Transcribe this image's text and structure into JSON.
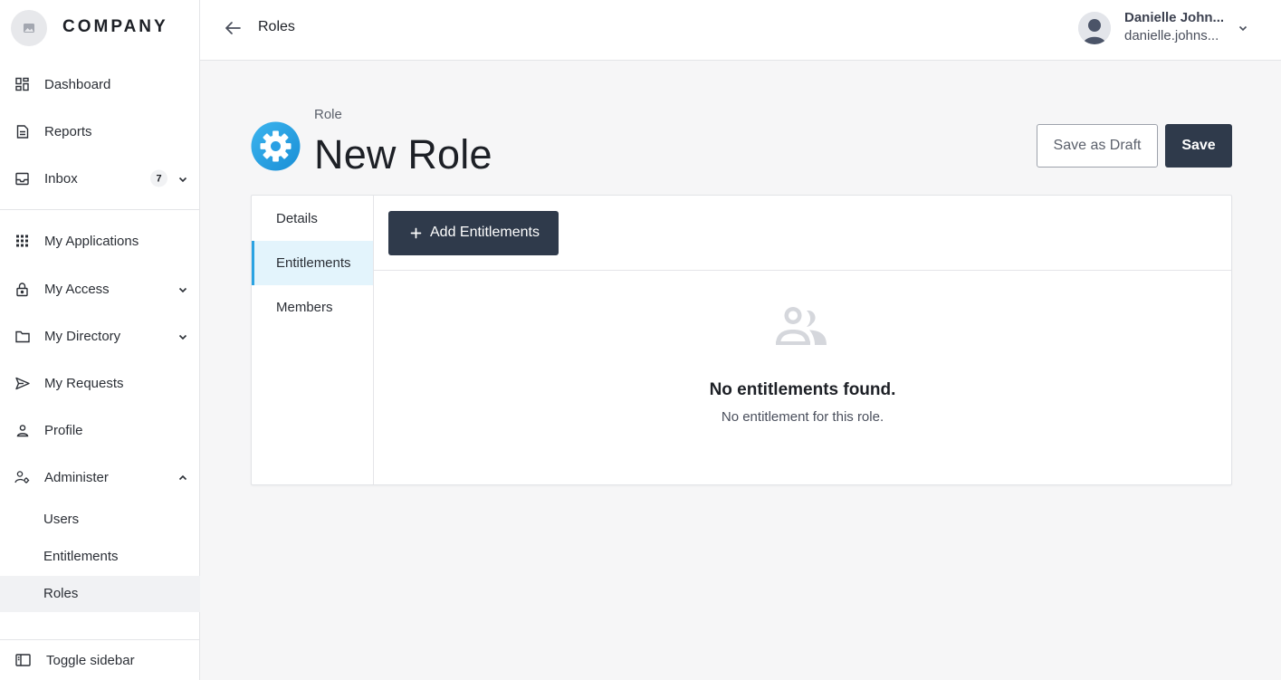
{
  "brand": {
    "name": "COMPANY",
    "logo_icon": "image-icon"
  },
  "sidebar": {
    "items": [
      {
        "label": "Dashboard",
        "icon": "dashboard-icon"
      },
      {
        "label": "Reports",
        "icon": "document-icon"
      },
      {
        "label": "Inbox",
        "icon": "inbox-icon",
        "badge": "7"
      },
      {
        "label": "My Applications",
        "icon": "grid-icon"
      },
      {
        "label": "My Access",
        "icon": "lock-icon"
      },
      {
        "label": "My Directory",
        "icon": "folder-icon"
      },
      {
        "label": "My Requests",
        "icon": "send-icon"
      },
      {
        "label": "Profile",
        "icon": "user-icon"
      },
      {
        "label": "Administer",
        "icon": "user-settings-icon"
      }
    ],
    "sub_items": [
      {
        "label": "Users"
      },
      {
        "label": "Entitlements"
      },
      {
        "label": "Roles",
        "active": true
      }
    ],
    "toggle_label": "Toggle sidebar"
  },
  "topbar": {
    "breadcrumb": "Roles",
    "user": {
      "name": "Danielle John...",
      "email": "danielle.johns..."
    }
  },
  "header": {
    "eyebrow": "Role",
    "title": "New Role",
    "draft_label": "Save as Draft",
    "save_label": "Save"
  },
  "tabs": [
    {
      "label": "Details"
    },
    {
      "label": "Entitlements",
      "active": true
    },
    {
      "label": "Members"
    }
  ],
  "toolbar": {
    "add_label": "Add Entitlements"
  },
  "empty_state": {
    "title": "No entitlements found.",
    "subtitle": "No entitlement for this role.",
    "icon": "users-icon"
  },
  "colors": {
    "accent": "#2ba3e2",
    "primary_button": "#2f3a4b",
    "active_tab_bg": "#e3f4fc",
    "background": "#f6f6f7"
  }
}
